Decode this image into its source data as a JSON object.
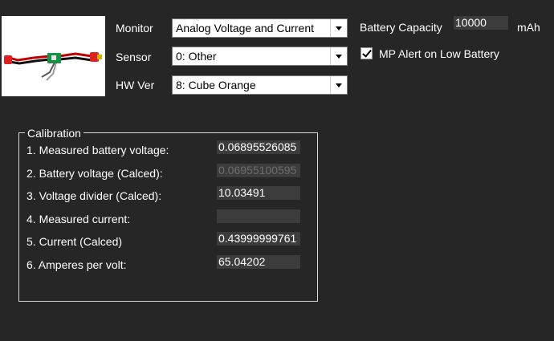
{
  "settings": {
    "monitor": {
      "label": "Monitor",
      "value": "Analog Voltage and Current"
    },
    "sensor": {
      "label": "Sensor",
      "value": "0: Other"
    },
    "hw_ver": {
      "label": "HW Ver",
      "value": "8: Cube Orange"
    },
    "battery_capacity": {
      "label": "Battery Capacity",
      "value": "10000",
      "unit": "mAh"
    },
    "low_battery_alert": {
      "label": "MP Alert on Low Battery",
      "checked": true
    }
  },
  "calibration": {
    "title": "Calibration",
    "rows": [
      {
        "label": "1. Measured battery voltage:",
        "value": "0.06895526085"
      },
      {
        "label": "2. Battery voltage (Calced):",
        "value": "0.06955100595"
      },
      {
        "label": "3. Voltage divider (Calced):",
        "value": "10.03491"
      },
      {
        "label": "4. Measured current:",
        "value": ""
      },
      {
        "label": "5. Current (Calced)",
        "value": "0.43999999761"
      },
      {
        "label": "6. Amperes per volt:",
        "value": "65.04202"
      }
    ]
  }
}
